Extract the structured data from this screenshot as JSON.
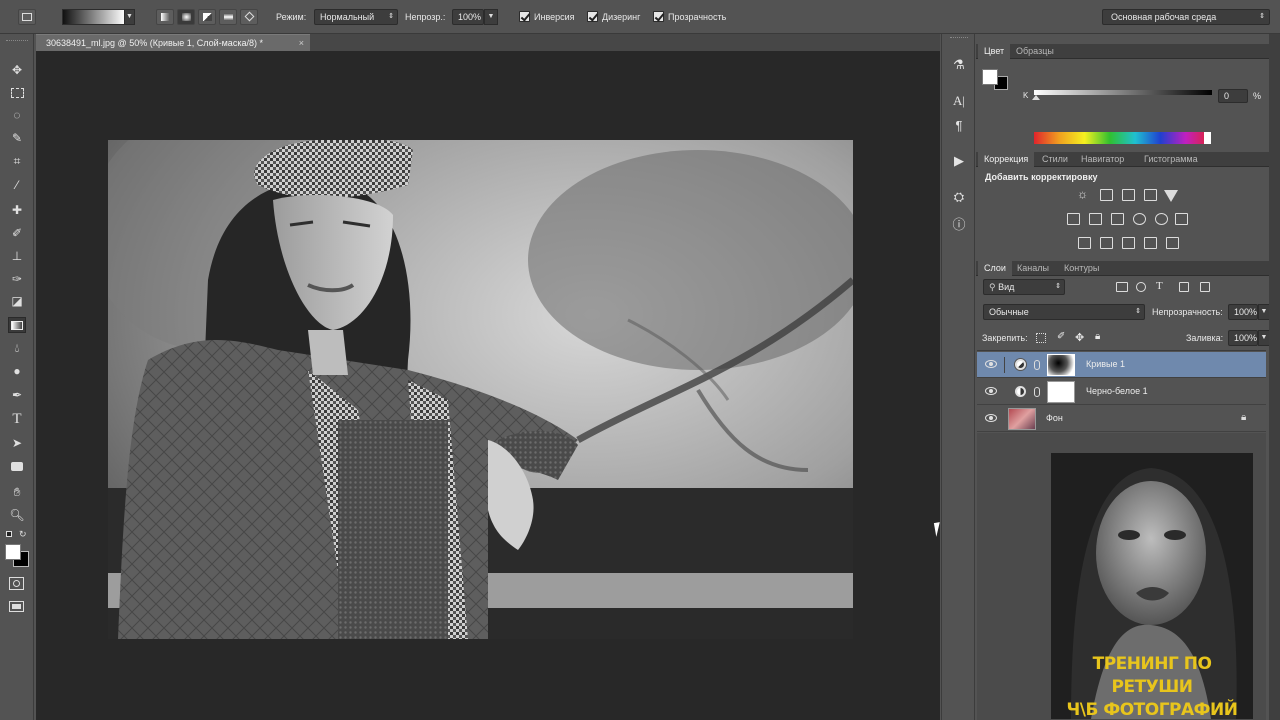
{
  "options_bar": {
    "mode_label": "Режим:",
    "mode_value": "Нормальный",
    "opacity_label": "Непрозр.:",
    "opacity_value": "100%",
    "checkbox_inverse": "Инверсия",
    "checkbox_dither": "Дизеринг",
    "checkbox_transparency": "Прозрачность",
    "workspace": "Основная рабочая среда"
  },
  "document": {
    "tab_title": "30638491_ml.jpg @ 50% (Кривые 1, Слой-маска/8) *",
    "close_glyph": "×"
  },
  "color_panel": {
    "tabs": [
      "Цвет",
      "Образцы"
    ],
    "channel_label": "K",
    "channel_value": "0",
    "unit": "%"
  },
  "adjustments_panel": {
    "tabs": [
      "Коррекция",
      "Стили",
      "Навигатор",
      "Гистограмма"
    ],
    "heading": "Добавить корректировку"
  },
  "layers_panel": {
    "tabs": [
      "Слои",
      "Каналы",
      "Контуры"
    ],
    "filter_value": "Вид",
    "blend_mode": "Обычные",
    "opacity_label": "Непрозрачность:",
    "opacity_value": "100%",
    "lock_label": "Закрепить:",
    "fill_label": "Заливка:",
    "fill_value": "100%",
    "layers": [
      {
        "name": "Кривые 1",
        "selected": true
      },
      {
        "name": "Черно-белое 1",
        "selected": false
      },
      {
        "name": "Фон",
        "selected": false
      }
    ]
  },
  "promo": {
    "line1": "ТРЕНИНГ ПО РЕТУШИ",
    "line2": "Ч\\Б ФОТОГРАФИЙ",
    "text_color": "#e8c51c"
  },
  "colors": {
    "selected_layer": "#6f89ad",
    "canvas_bg": "#282828"
  }
}
